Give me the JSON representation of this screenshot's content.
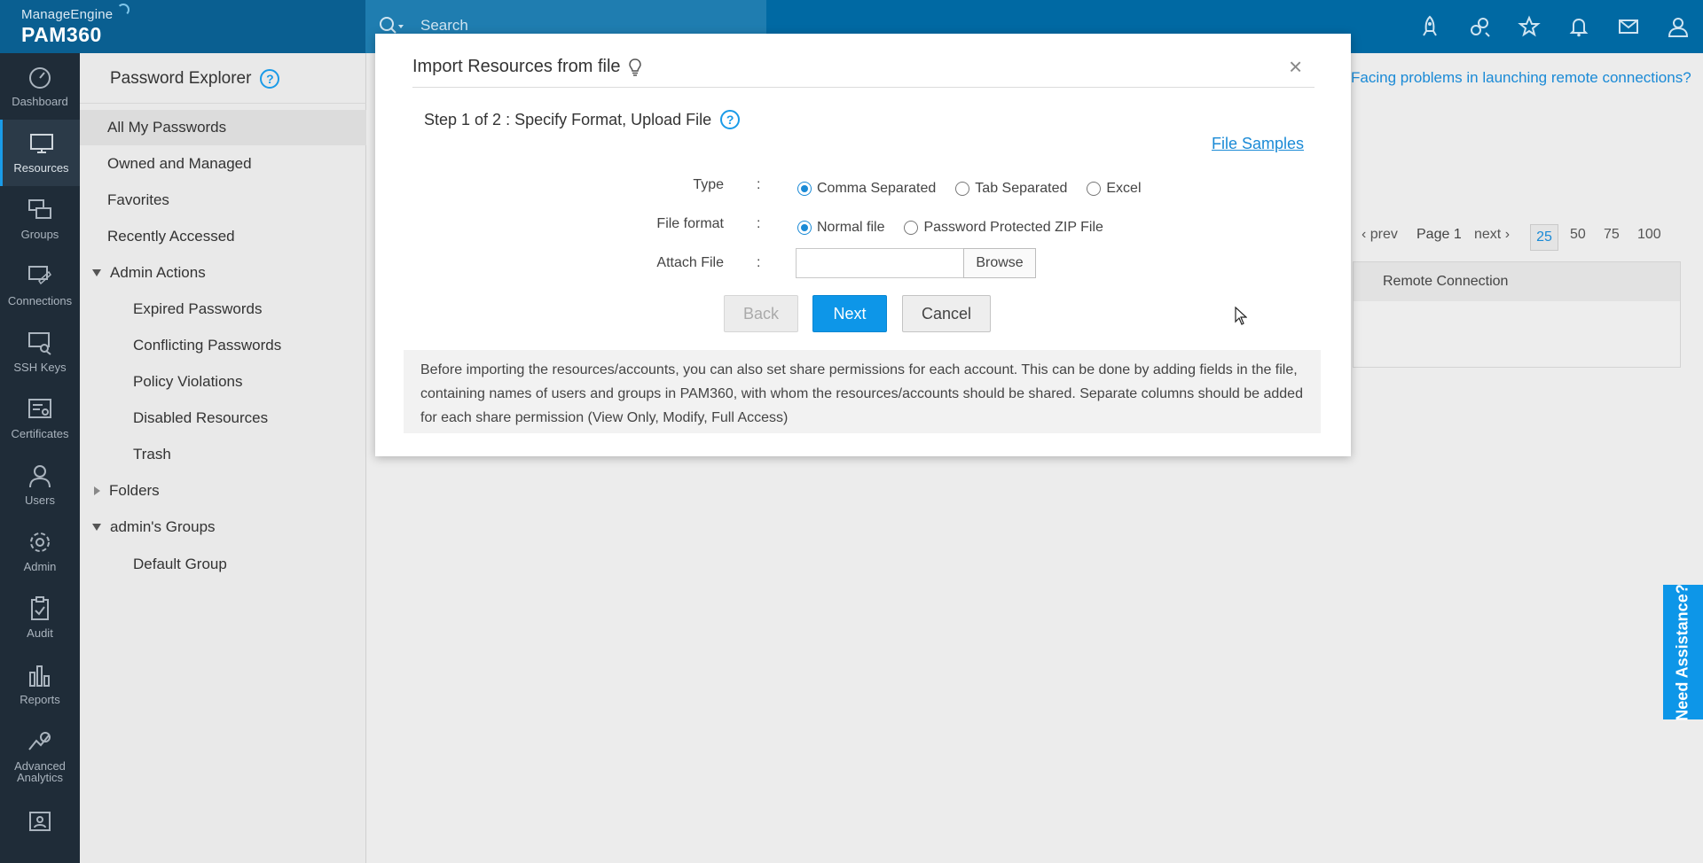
{
  "header": {
    "brand": "ManageEngine",
    "product": "PAM360",
    "search_placeholder": "Search",
    "icons": [
      "rocket-icon",
      "integration-icon",
      "star-user-icon",
      "bell-icon",
      "mail-icon",
      "user-profile-icon"
    ]
  },
  "leftnav": {
    "items": [
      {
        "label": "Dashboard",
        "icon": "dashboard-icon"
      },
      {
        "label": "Resources",
        "icon": "monitor-icon"
      },
      {
        "label": "Groups",
        "icon": "groups-icon"
      },
      {
        "label": "Connections",
        "icon": "connections-icon"
      },
      {
        "label": "SSH Keys",
        "icon": "ssh-key-icon"
      },
      {
        "label": "Certificates",
        "icon": "certificate-icon"
      },
      {
        "label": "Users",
        "icon": "user-icon"
      },
      {
        "label": "Admin",
        "icon": "gear-icon"
      },
      {
        "label": "Audit",
        "icon": "clipboard-icon"
      },
      {
        "label": "Reports",
        "icon": "bar-chart-icon"
      },
      {
        "label": "Advanced",
        "label2": "Analytics",
        "icon": "analytics-icon"
      },
      {
        "label": "",
        "icon": "id-card-icon"
      }
    ],
    "active_index": 1
  },
  "sidebar": {
    "title": "Password Explorer",
    "items": [
      {
        "label": "All My Passwords"
      },
      {
        "label": "Owned and Managed"
      },
      {
        "label": "Favorites"
      },
      {
        "label": "Recently Accessed"
      },
      {
        "label": "Admin Actions"
      },
      {
        "label": "Expired Passwords"
      },
      {
        "label": "Conflicting Passwords"
      },
      {
        "label": "Policy Violations"
      },
      {
        "label": "Disabled Resources"
      },
      {
        "label": "Trash"
      },
      {
        "label": "Folders"
      },
      {
        "label": "admin's Groups"
      },
      {
        "label": "Default Group"
      }
    ]
  },
  "main": {
    "remote_help_link": "Facing problems in launching remote connections?",
    "pager": {
      "prev": "prev",
      "page": "Page 1",
      "next": "next",
      "sizes": [
        "25",
        "50",
        "75",
        "100"
      ],
      "selected_size": "25"
    },
    "table": {
      "column": "Remote Connection"
    }
  },
  "modal": {
    "title": "Import Resources from file",
    "close": "×",
    "step": "Step 1 of 2 : Specify Format, Upload File",
    "file_samples": "File Samples",
    "type": {
      "label": "Type",
      "colon": ":",
      "options": [
        "Comma Separated",
        "Tab Separated",
        "Excel"
      ],
      "selected": "Comma Separated"
    },
    "file_format": {
      "label": "File format",
      "colon": ":",
      "options": [
        "Normal file",
        "Password Protected ZIP File"
      ],
      "selected": "Normal file"
    },
    "attach": {
      "label": "Attach File",
      "colon": ":",
      "browse": "Browse",
      "value": ""
    },
    "buttons": {
      "back": "Back",
      "next": "Next",
      "cancel": "Cancel"
    },
    "info_text": "Before importing the resources/accounts, you can also set share permissions for each account. This can be done by adding fields in the file, containing names of users and groups in PAM360, with whom the resources/accounts should be shared. Separate columns should be added for each share permission (View Only, Modify, Full Access)"
  },
  "assist": {
    "label": "Need Assistance?"
  }
}
